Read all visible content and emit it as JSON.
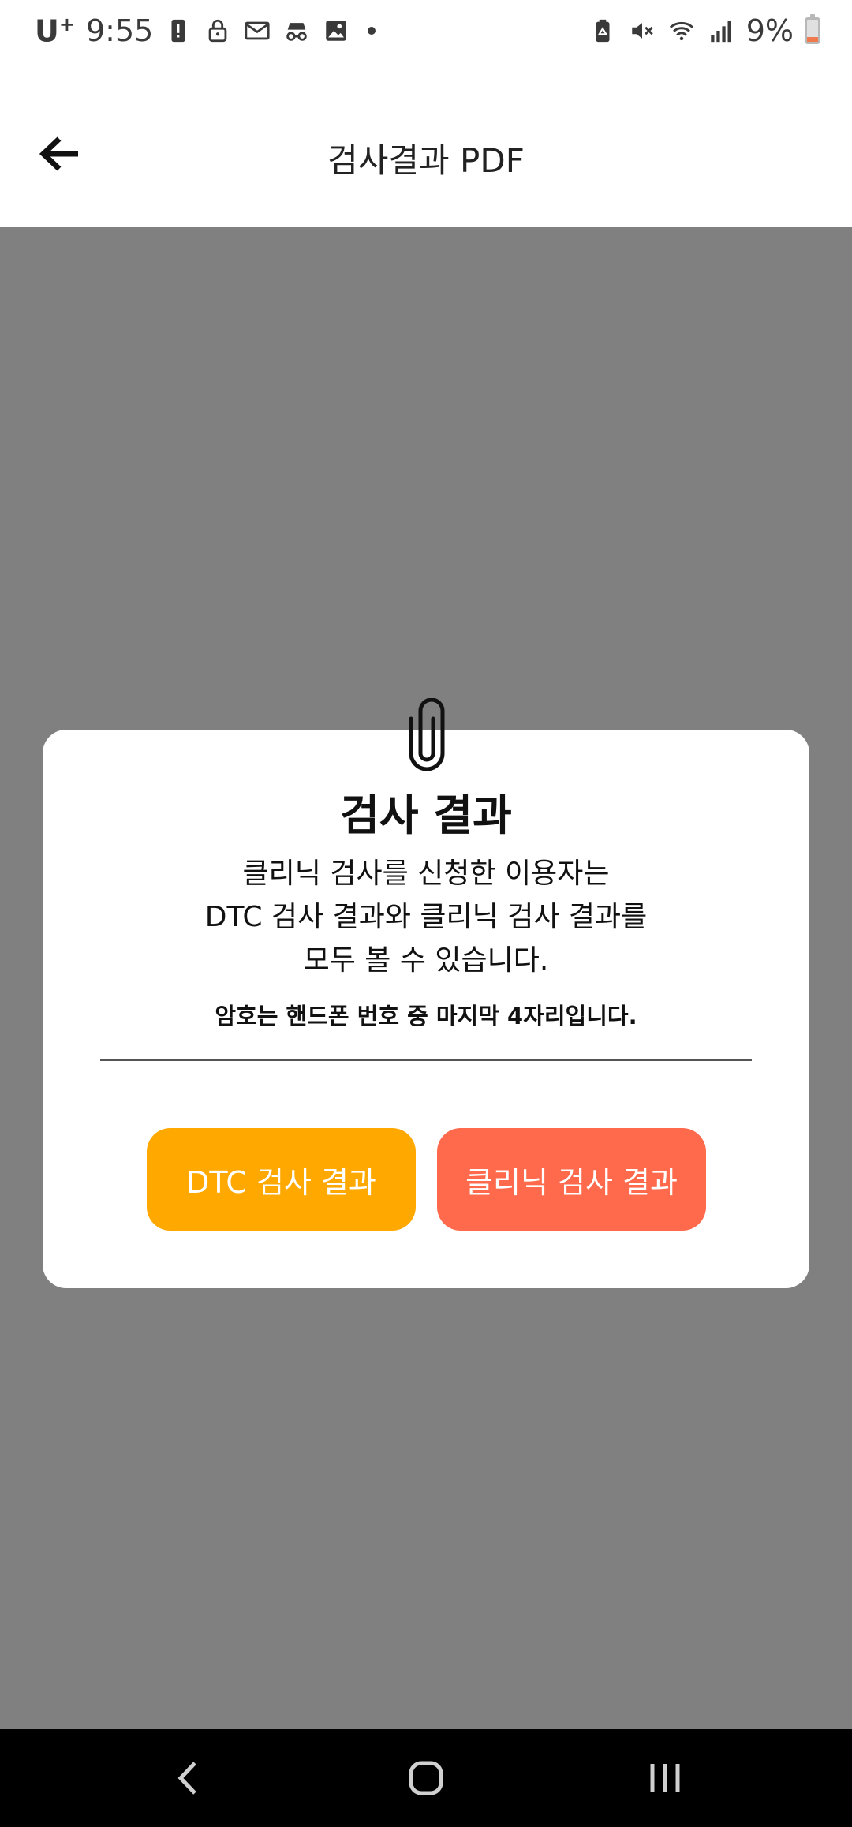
{
  "status_bar": {
    "carrier": "U",
    "carrier_sup": "+",
    "time": "9:55",
    "battery_percent": "9%",
    "battery_level": 0.09,
    "left_icons": [
      "alert-icon",
      "lock-icon",
      "mail-icon",
      "incognito-icon",
      "image-icon",
      "notification-dot"
    ],
    "right_icons": [
      "recycle-battery-icon",
      "mute-icon",
      "wifi-icon",
      "signal-icon"
    ]
  },
  "app_bar": {
    "title": "검사결과 PDF",
    "back_icon": "arrow-back-icon"
  },
  "dialog": {
    "icon": "paperclip-icon",
    "title": "검사 결과",
    "message_lines": [
      "클리닉 검사를 신청한 이용자는",
      "DTC 검사 결과와 클리닉 검사 결과를",
      "모두 볼 수 있습니다."
    ],
    "note": "암호는 핸드폰 번호 중 마지막 4자리입니다.",
    "buttons": {
      "dtc_label": "DTC 검사 결과",
      "clinic_label": "클리닉 검사 결과"
    }
  },
  "colors": {
    "overlay": "#808080",
    "dtc_button": "#FFA800",
    "clinic_button": "#FF6A4D",
    "battery_low": "#F07A4E"
  },
  "nav_bar": {
    "icons": [
      "nav-back-icon",
      "nav-home-icon",
      "nav-recents-icon"
    ]
  }
}
